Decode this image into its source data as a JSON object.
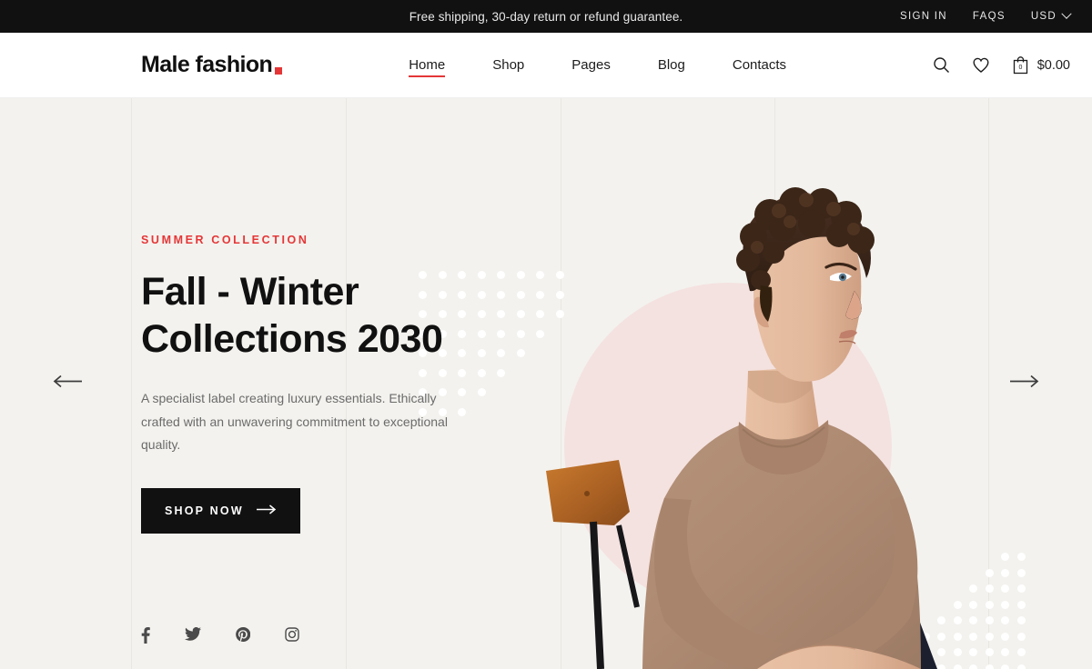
{
  "topbar": {
    "message": "Free shipping, 30-day return or refund guarantee.",
    "sign_in": "SIGN IN",
    "faqs": "FAQS",
    "currency": "USD",
    "chevron_icon": "chevron-down-icon",
    "bg_color": "#111111"
  },
  "header": {
    "logo_text": "Male fashion",
    "logo_dot_color": "#e53637",
    "nav": [
      {
        "label": "Home",
        "active": true
      },
      {
        "label": "Shop",
        "active": false
      },
      {
        "label": "Pages",
        "active": false
      },
      {
        "label": "Blog",
        "active": false
      },
      {
        "label": "Contacts",
        "active": false
      }
    ],
    "search_icon": "search-icon",
    "wishlist_icon": "heart-icon",
    "cart_icon": "shopping-bag-icon",
    "cart_count": "0",
    "cart_total": "$0.00"
  },
  "hero": {
    "eyebrow": "SUMMER COLLECTION",
    "title_line1": "Fall - Winter",
    "title_line2": "Collections 2030",
    "description": "A specialist label creating luxury essentials. Ethically crafted with an unwavering commitment to exceptional quality.",
    "cta_label": "SHOP NOW",
    "cta_arrow_icon": "arrow-right-icon",
    "prev_icon": "arrow-left-icon",
    "next_icon": "arrow-right-icon",
    "accent_color": "#e53637",
    "background_color": "#f3f2ee",
    "circle_color": "#f4e2e0",
    "socials": [
      {
        "name": "facebook-icon"
      },
      {
        "name": "twitter-icon"
      },
      {
        "name": "pinterest-icon"
      },
      {
        "name": "instagram-icon"
      }
    ]
  }
}
